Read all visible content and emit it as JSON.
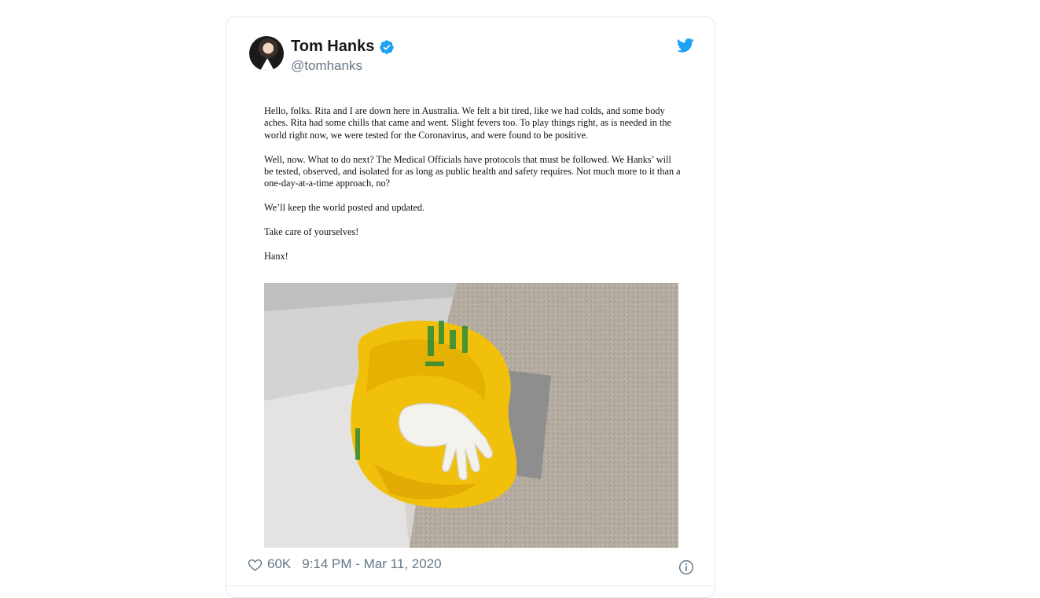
{
  "tweet": {
    "author_name": "Tom Hanks",
    "author_handle": "@tomhanks",
    "verified": true,
    "brand_color": "#1da1f2",
    "body_paragraphs": [
      "Hello, folks. Rita and I are down here in Australia. We felt a bit tired, like we had colds, and some body aches. Rita had some chills that came and went. Slight fevers too. To play things right, as is needed in the world right now, we were tested for the Coronavirus, and were found to be positive.",
      "Well, now. What to do next? The Medical Officials have protocols that must be followed. We Hanks’ will be tested, observed, and isolated for as long as public health and safety requires.  Not much more to it than a one-day-at-a-time approach, no?",
      "We’ll keep the world posted and updated.",
      "Take care of yourselves!",
      "Hanx!"
    ],
    "likes": "60K",
    "timestamp": "9:14 PM - Mar 11, 2020"
  },
  "icons": {
    "twitter": "twitter-bird-icon",
    "verified": "verified-badge-icon",
    "like": "heart-icon",
    "info": "info-icon"
  }
}
